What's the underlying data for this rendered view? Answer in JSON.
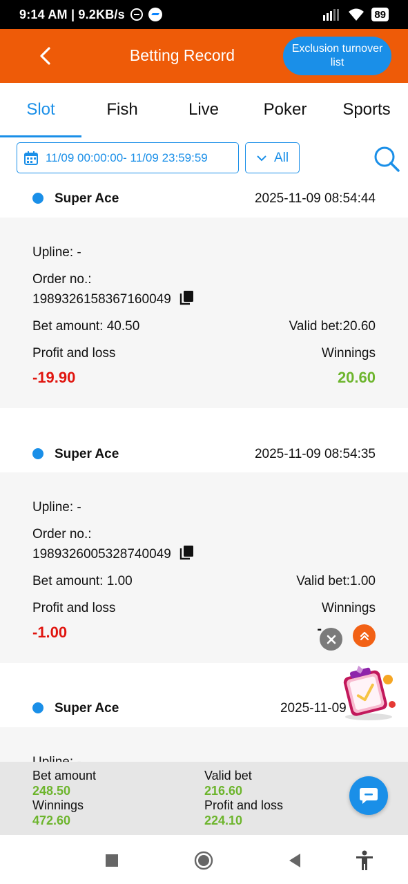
{
  "status_bar": {
    "time_speed": "9:14 AM | 9.2KB/s",
    "battery": "89"
  },
  "header": {
    "title": "Betting Record",
    "exclusion_button": "Exclusion turnover list"
  },
  "tabs": [
    {
      "label": "Slot",
      "active": true
    },
    {
      "label": "Fish",
      "active": false
    },
    {
      "label": "Live",
      "active": false
    },
    {
      "label": "Poker",
      "active": false
    },
    {
      "label": "Sports",
      "active": false
    }
  ],
  "filter": {
    "date_range": "11/09 00:00:00- 11/09 23:59:59",
    "status_select": "All"
  },
  "labels": {
    "upline": "Upline: -",
    "order_no": "Order no.:",
    "profit_and_loss": "Profit and loss",
    "winnings": "Winnings"
  },
  "records": [
    {
      "game": "Super Ace",
      "time": "2025-11-09 08:54:44",
      "order_no": "1989326158367160049",
      "bet_amount": "Bet amount: 40.50",
      "valid_bet": "Valid bet:20.60",
      "profit_loss": "-19.90",
      "winnings": "20.60"
    },
    {
      "game": "Super Ace",
      "time": "2025-11-09 08:54:35",
      "order_no": "1989326005328740049",
      "bet_amount": "Bet amount: 1.00",
      "valid_bet": "Valid bet:1.00",
      "profit_loss": "-1.00",
      "winnings": "-"
    },
    {
      "game": "Super Ace",
      "time": "2025-11-09 08:5"
    }
  ],
  "summary": {
    "bet_amount_label": "Bet amount",
    "bet_amount": "248.50",
    "valid_bet_label": "Valid bet",
    "valid_bet": "216.60",
    "winnings_label": "Winnings",
    "winnings": "472.60",
    "profit_loss_label": "Profit and loss",
    "profit_loss": "224.10"
  },
  "colors": {
    "header_orange": "#ee5b08",
    "accent_blue": "#1a8fe8",
    "loss_red": "#e0150f",
    "win_green": "#6db52d"
  }
}
